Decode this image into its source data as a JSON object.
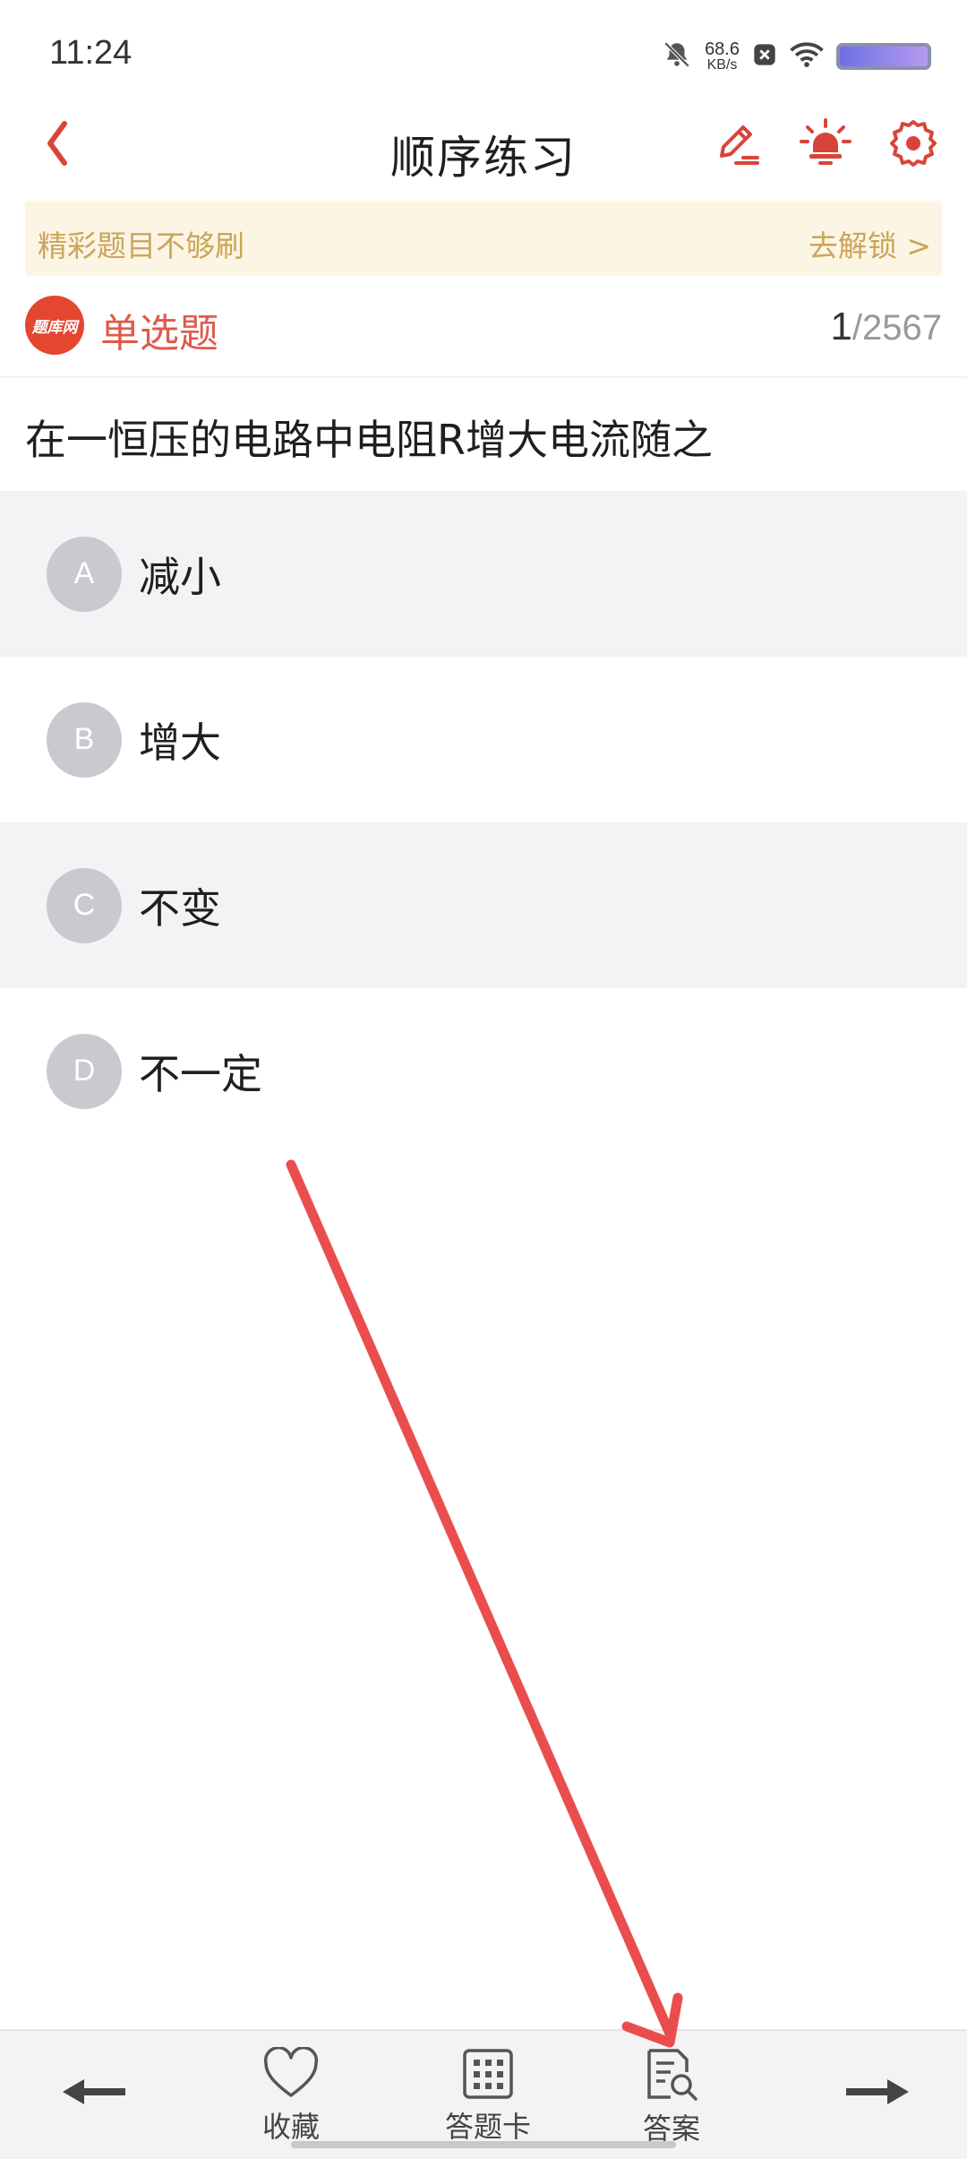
{
  "status_bar": {
    "time": "11:24",
    "net_speed_value": "68.6",
    "net_speed_unit": "KB/s",
    "icons": [
      "mute-bell-icon",
      "close-box-icon",
      "wifi-icon",
      "battery-icon"
    ]
  },
  "header": {
    "title": "顺序练习",
    "icons": [
      "back-chevron-icon",
      "edit-pen-icon",
      "lightbulb-icon",
      "gear-icon"
    ],
    "accent_color": "#e0453a"
  },
  "promo": {
    "text": "精彩题目不够刷",
    "action": "去解锁 >"
  },
  "question_meta": {
    "logo_text": "题库网",
    "type": "单选题",
    "current": "1",
    "total": "/2567"
  },
  "question": {
    "text": "在一恒压的电路中电阻R增大电流随之"
  },
  "options": [
    {
      "letter": "A",
      "text": "减小"
    },
    {
      "letter": "B",
      "text": "增大"
    },
    {
      "letter": "C",
      "text": "不变"
    },
    {
      "letter": "D",
      "text": "不一定"
    }
  ],
  "bottom_bar": {
    "favorite_label": "收藏",
    "answer_card_label": "答题卡",
    "answer_label": "答案",
    "icons": [
      "arrow-left-icon",
      "heart-icon",
      "grid-icon",
      "document-search-icon",
      "arrow-right-icon"
    ]
  }
}
